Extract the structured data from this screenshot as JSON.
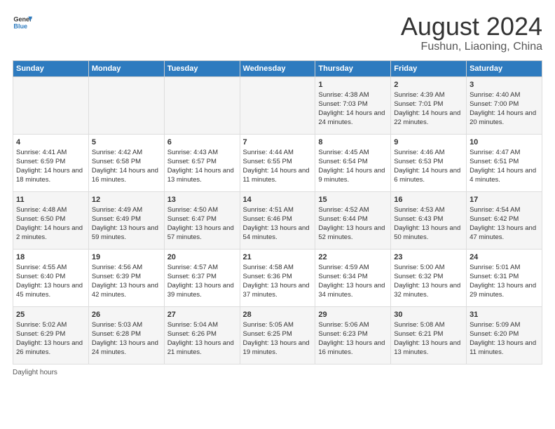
{
  "header": {
    "logo_general": "General",
    "logo_blue": "Blue",
    "main_title": "August 2024",
    "sub_title": "Fushun, Liaoning, China"
  },
  "days_of_week": [
    "Sunday",
    "Monday",
    "Tuesday",
    "Wednesday",
    "Thursday",
    "Friday",
    "Saturday"
  ],
  "weeks": [
    [
      {
        "day": "",
        "info": ""
      },
      {
        "day": "",
        "info": ""
      },
      {
        "day": "",
        "info": ""
      },
      {
        "day": "",
        "info": ""
      },
      {
        "day": "1",
        "info": "Sunrise: 4:38 AM\nSunset: 7:03 PM\nDaylight: 14 hours and 24 minutes."
      },
      {
        "day": "2",
        "info": "Sunrise: 4:39 AM\nSunset: 7:01 PM\nDaylight: 14 hours and 22 minutes."
      },
      {
        "day": "3",
        "info": "Sunrise: 4:40 AM\nSunset: 7:00 PM\nDaylight: 14 hours and 20 minutes."
      }
    ],
    [
      {
        "day": "4",
        "info": "Sunrise: 4:41 AM\nSunset: 6:59 PM\nDaylight: 14 hours and 18 minutes."
      },
      {
        "day": "5",
        "info": "Sunrise: 4:42 AM\nSunset: 6:58 PM\nDaylight: 14 hours and 16 minutes."
      },
      {
        "day": "6",
        "info": "Sunrise: 4:43 AM\nSunset: 6:57 PM\nDaylight: 14 hours and 13 minutes."
      },
      {
        "day": "7",
        "info": "Sunrise: 4:44 AM\nSunset: 6:55 PM\nDaylight: 14 hours and 11 minutes."
      },
      {
        "day": "8",
        "info": "Sunrise: 4:45 AM\nSunset: 6:54 PM\nDaylight: 14 hours and 9 minutes."
      },
      {
        "day": "9",
        "info": "Sunrise: 4:46 AM\nSunset: 6:53 PM\nDaylight: 14 hours and 6 minutes."
      },
      {
        "day": "10",
        "info": "Sunrise: 4:47 AM\nSunset: 6:51 PM\nDaylight: 14 hours and 4 minutes."
      }
    ],
    [
      {
        "day": "11",
        "info": "Sunrise: 4:48 AM\nSunset: 6:50 PM\nDaylight: 14 hours and 2 minutes."
      },
      {
        "day": "12",
        "info": "Sunrise: 4:49 AM\nSunset: 6:49 PM\nDaylight: 13 hours and 59 minutes."
      },
      {
        "day": "13",
        "info": "Sunrise: 4:50 AM\nSunset: 6:47 PM\nDaylight: 13 hours and 57 minutes."
      },
      {
        "day": "14",
        "info": "Sunrise: 4:51 AM\nSunset: 6:46 PM\nDaylight: 13 hours and 54 minutes."
      },
      {
        "day": "15",
        "info": "Sunrise: 4:52 AM\nSunset: 6:44 PM\nDaylight: 13 hours and 52 minutes."
      },
      {
        "day": "16",
        "info": "Sunrise: 4:53 AM\nSunset: 6:43 PM\nDaylight: 13 hours and 50 minutes."
      },
      {
        "day": "17",
        "info": "Sunrise: 4:54 AM\nSunset: 6:42 PM\nDaylight: 13 hours and 47 minutes."
      }
    ],
    [
      {
        "day": "18",
        "info": "Sunrise: 4:55 AM\nSunset: 6:40 PM\nDaylight: 13 hours and 45 minutes."
      },
      {
        "day": "19",
        "info": "Sunrise: 4:56 AM\nSunset: 6:39 PM\nDaylight: 13 hours and 42 minutes."
      },
      {
        "day": "20",
        "info": "Sunrise: 4:57 AM\nSunset: 6:37 PM\nDaylight: 13 hours and 39 minutes."
      },
      {
        "day": "21",
        "info": "Sunrise: 4:58 AM\nSunset: 6:36 PM\nDaylight: 13 hours and 37 minutes."
      },
      {
        "day": "22",
        "info": "Sunrise: 4:59 AM\nSunset: 6:34 PM\nDaylight: 13 hours and 34 minutes."
      },
      {
        "day": "23",
        "info": "Sunrise: 5:00 AM\nSunset: 6:32 PM\nDaylight: 13 hours and 32 minutes."
      },
      {
        "day": "24",
        "info": "Sunrise: 5:01 AM\nSunset: 6:31 PM\nDaylight: 13 hours and 29 minutes."
      }
    ],
    [
      {
        "day": "25",
        "info": "Sunrise: 5:02 AM\nSunset: 6:29 PM\nDaylight: 13 hours and 26 minutes."
      },
      {
        "day": "26",
        "info": "Sunrise: 5:03 AM\nSunset: 6:28 PM\nDaylight: 13 hours and 24 minutes."
      },
      {
        "day": "27",
        "info": "Sunrise: 5:04 AM\nSunset: 6:26 PM\nDaylight: 13 hours and 21 minutes."
      },
      {
        "day": "28",
        "info": "Sunrise: 5:05 AM\nSunset: 6:25 PM\nDaylight: 13 hours and 19 minutes."
      },
      {
        "day": "29",
        "info": "Sunrise: 5:06 AM\nSunset: 6:23 PM\nDaylight: 13 hours and 16 minutes."
      },
      {
        "day": "30",
        "info": "Sunrise: 5:08 AM\nSunset: 6:21 PM\nDaylight: 13 hours and 13 minutes."
      },
      {
        "day": "31",
        "info": "Sunrise: 5:09 AM\nSunset: 6:20 PM\nDaylight: 13 hours and 11 minutes."
      }
    ]
  ],
  "footer": {
    "daylight_label": "Daylight hours"
  }
}
